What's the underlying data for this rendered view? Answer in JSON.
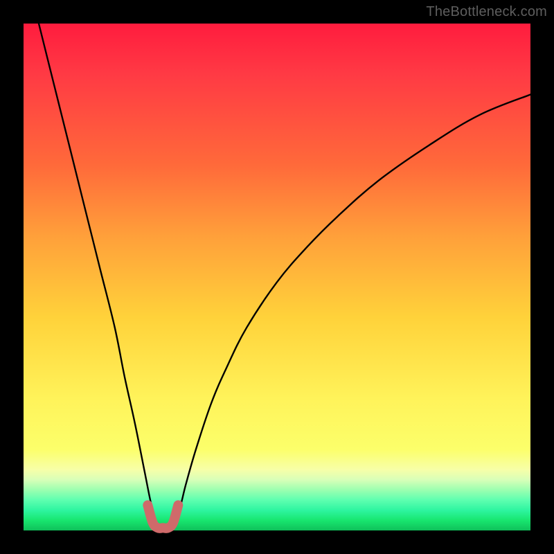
{
  "watermark": "TheBottleneck.com",
  "chart_data": {
    "type": "line",
    "title": "",
    "xlabel": "",
    "ylabel": "",
    "xlim": [
      0,
      100
    ],
    "ylim": [
      0,
      100
    ],
    "grid": false,
    "legend": false,
    "background_gradient": {
      "top": "#ff1c3e",
      "mid": "#ffd23a",
      "bottom": "#0fc05a"
    },
    "series": [
      {
        "name": "bottleneck-curve",
        "color": "#000000",
        "x": [
          3,
          6,
          9,
          12,
          15,
          18,
          20,
          22,
          24,
          25,
          26,
          27,
          28,
          29,
          30,
          31,
          32,
          34,
          37,
          40,
          44,
          50,
          56,
          62,
          70,
          80,
          90,
          100
        ],
        "y": [
          100,
          88,
          76,
          64,
          52,
          40,
          30,
          21,
          11,
          6,
          2,
          0,
          0,
          0,
          2,
          5,
          9,
          16,
          25,
          32,
          40,
          49,
          56,
          62,
          69,
          76,
          82,
          86
        ]
      },
      {
        "name": "optimal-band",
        "color": "#cf6a6a",
        "x": [
          24.5,
          25.5,
          26.5,
          27.5,
          28.5,
          29.5,
          30.5
        ],
        "y": [
          5,
          1.5,
          0.5,
          0.5,
          0.5,
          1.5,
          5
        ]
      }
    ]
  }
}
